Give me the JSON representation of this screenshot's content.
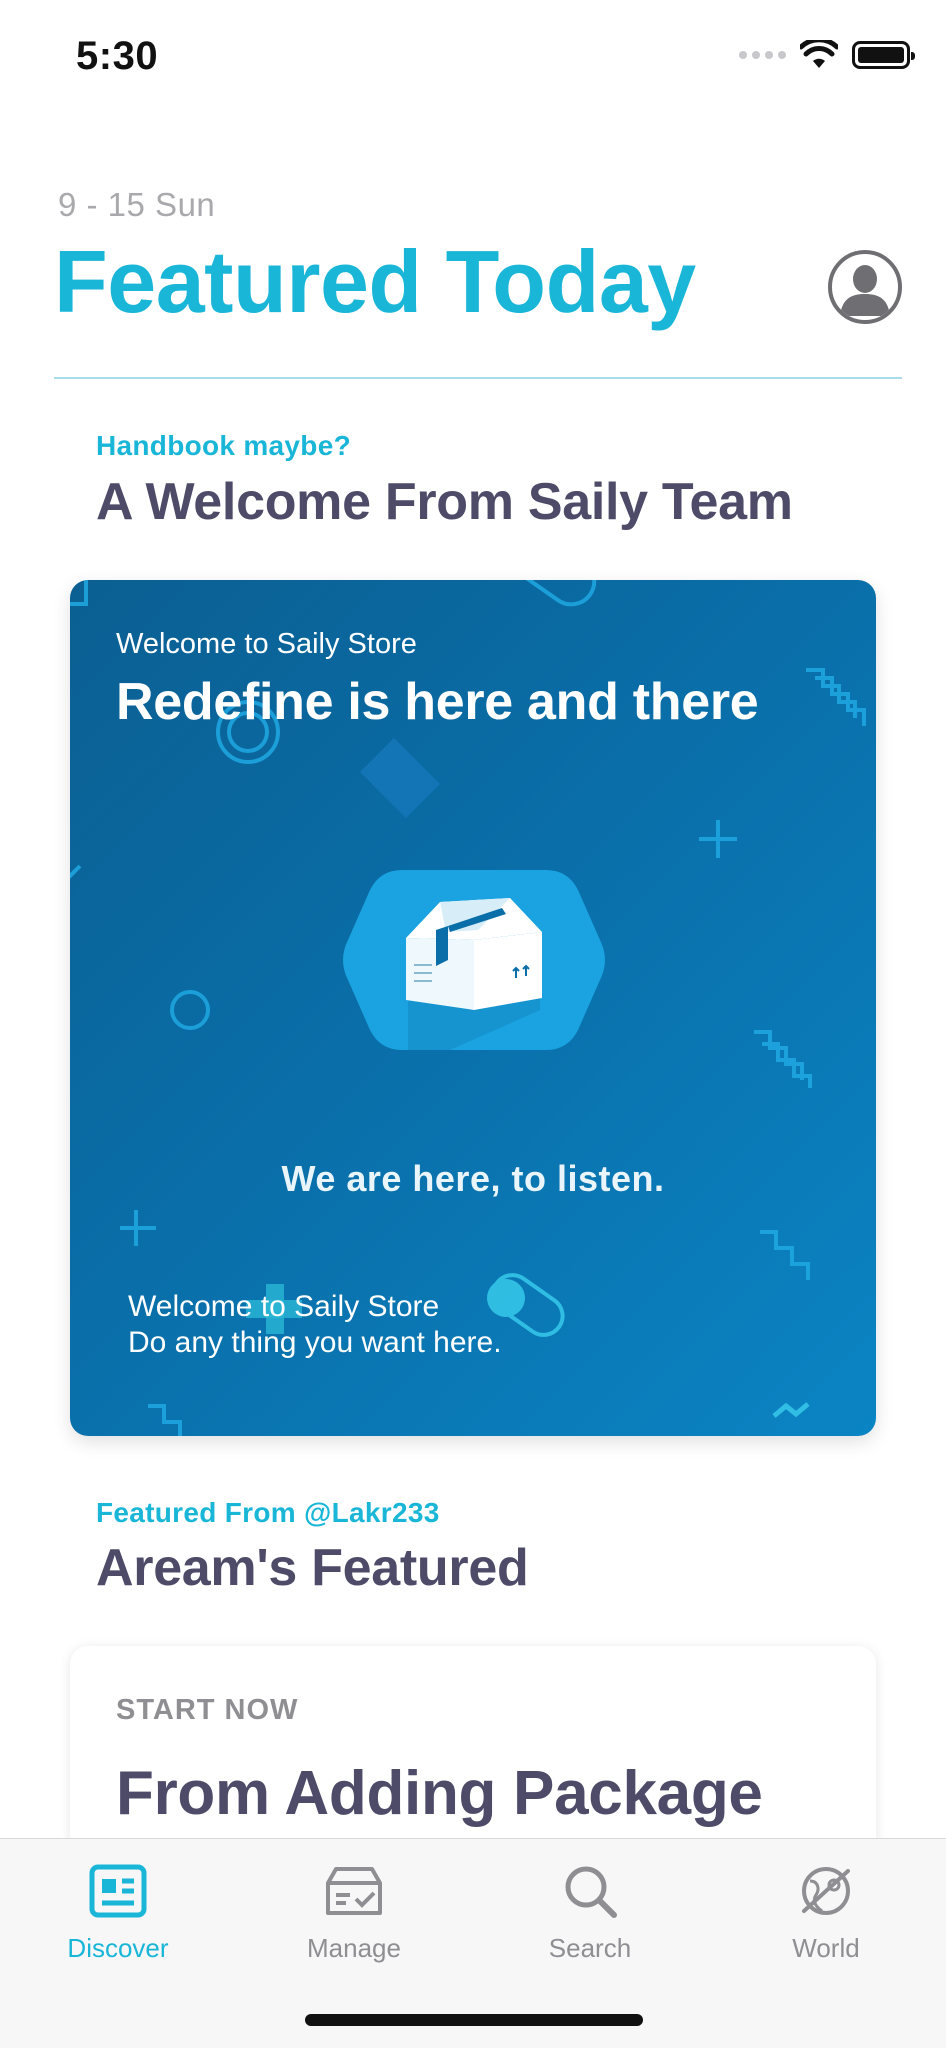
{
  "status_bar": {
    "time": "5:30"
  },
  "header": {
    "date": "9 - 15 Sun",
    "title": "Featured Today"
  },
  "sections": [
    {
      "kicker": "Handbook maybe?",
      "title": "A Welcome From Saily Team",
      "card": {
        "subtitle": "Welcome to Saily Store",
        "title": "Redefine is here and there",
        "tagline": "We are here, to listen.",
        "footer_line1": "Welcome to Saily Store",
        "footer_line2": "Do any thing you want here."
      }
    },
    {
      "kicker": "Featured From @Lakr233",
      "title": "Aream's Featured",
      "card": {
        "kicker": "START NOW",
        "title": "From Adding Package"
      }
    }
  ],
  "tab_bar": {
    "tabs": [
      {
        "label": "Discover",
        "icon": "newspaper-icon",
        "active": true
      },
      {
        "label": "Manage",
        "icon": "inbox-check-icon",
        "active": false
      },
      {
        "label": "Search",
        "icon": "magnifier-icon",
        "active": false
      },
      {
        "label": "World",
        "icon": "planet-icon",
        "active": false
      }
    ]
  },
  "colors": {
    "accent": "#19b6d8",
    "heading": "#4d4b68",
    "muted": "#8e8e93",
    "card_blue": "#0a6ea8"
  }
}
